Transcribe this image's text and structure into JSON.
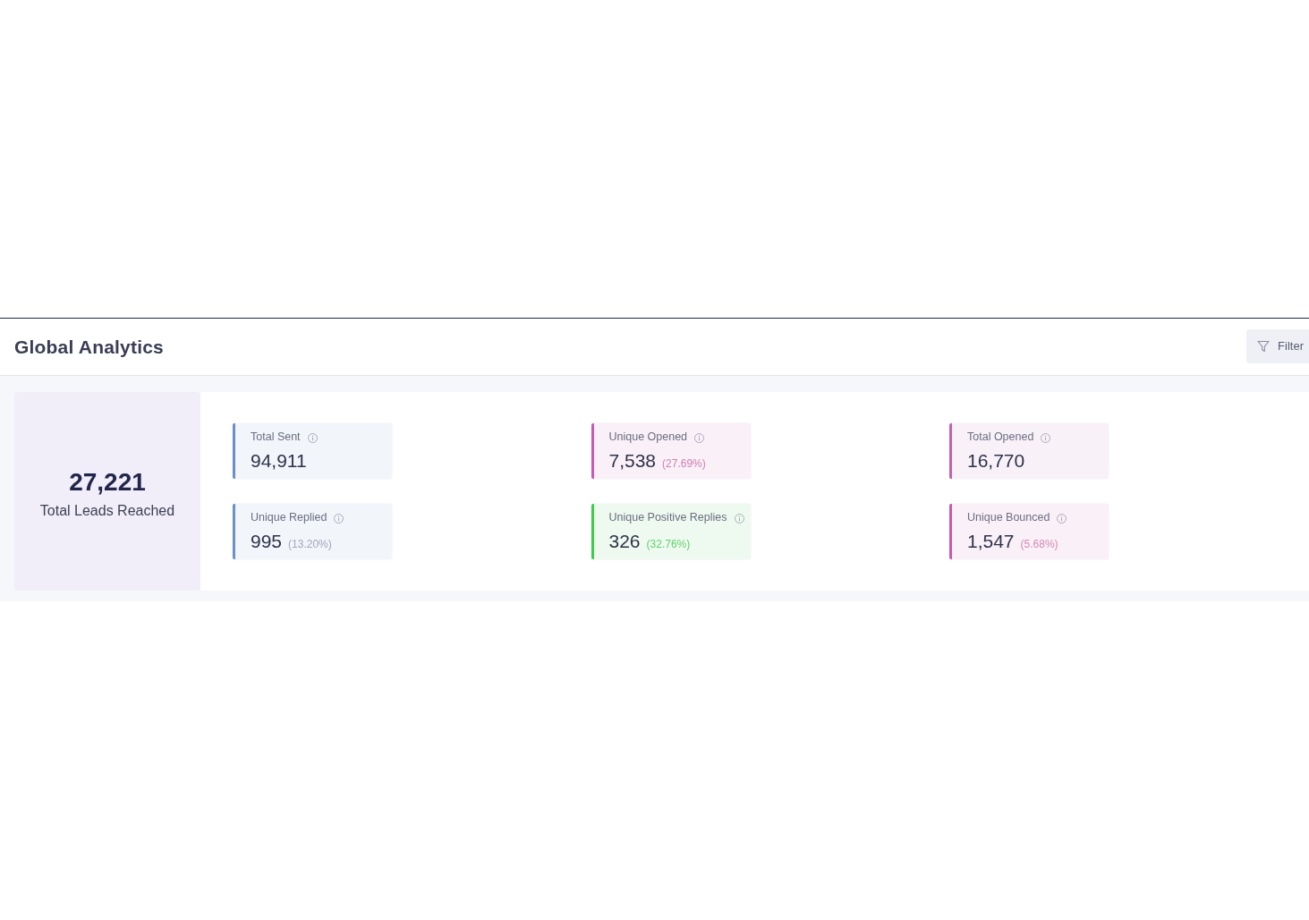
{
  "header": {
    "title": "Global Analytics",
    "filter_button": {
      "label": "Filter"
    }
  },
  "summary": {
    "value": "27,221",
    "label": "Total Leads Reached"
  },
  "stats": [
    {
      "label": "Total Sent",
      "value": "94,911",
      "color": "#6b8fc9"
    },
    {
      "label": "Unique Opened",
      "value": "7,538",
      "percent": {
        "text": "(27.69%)",
        "color": "#d17fb0"
      },
      "color": "#c75bb0"
    },
    {
      "label": "Total Opened",
      "value": "16,770",
      "color": "#c064b0"
    },
    {
      "label": "Unique Replied",
      "value": "995",
      "percent": {
        "text": "(13.20%)",
        "color": "#a3a7b8"
      },
      "color": "#6b93c4"
    },
    {
      "label": "Unique Positive Replies",
      "value": "326",
      "percent": {
        "text": "(32.76%)",
        "color": "#62d06f"
      },
      "color": "#3fcc4a"
    },
    {
      "label": "Unique Bounced",
      "value": "1,547",
      "percent": {
        "text": "(5.68%)",
        "color": "#d48bb5"
      },
      "color": "#c75bb0"
    }
  ]
}
